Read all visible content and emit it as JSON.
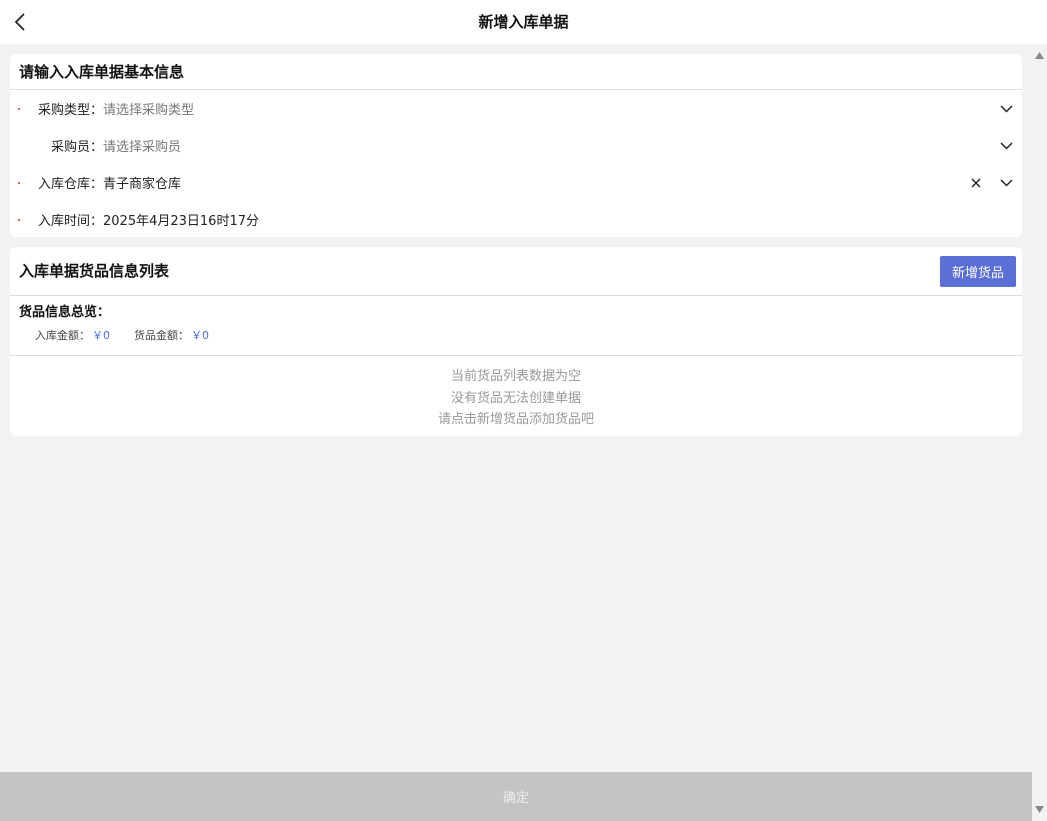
{
  "header": {
    "title": "新增入库单据"
  },
  "basic_info": {
    "title": "请输入入库单据基本信息",
    "fields": [
      {
        "label": "采购类型：",
        "value": "请选择采购类型",
        "is_placeholder": true,
        "required": true
      },
      {
        "label": "采购员：",
        "value": "请选择采购员",
        "is_placeholder": true,
        "required": false
      },
      {
        "label": "入库仓库：",
        "value": "青子商家仓库",
        "is_placeholder": false,
        "required": true
      },
      {
        "label": "入库时间：",
        "value": "2025年4月23日16时17分",
        "is_placeholder": false,
        "required": true
      }
    ]
  },
  "goods": {
    "title": "入库单据货品信息列表",
    "add_button_label": "新增货品",
    "summary_title": "货品信息总览：",
    "stock_amount_label": "入库金额：",
    "stock_amount_value": "￥0",
    "goods_amount_label": "货品金额：",
    "goods_amount_value": "￥0",
    "empty_lines": [
      "当前货品列表数据为空",
      "没有货品无法创建单据",
      "请点击新增货品添加货品吧"
    ]
  },
  "footer": {
    "confirm_label": "确定"
  },
  "colors": {
    "accent": "#5b6fd6",
    "amount": "#4a6fe0",
    "required": "#d9302c",
    "disabled_button": "#c4c4c4"
  },
  "icons": {
    "back": "chevron-left-icon",
    "dropdown": "chevron-down-icon",
    "clear": "close-icon"
  }
}
